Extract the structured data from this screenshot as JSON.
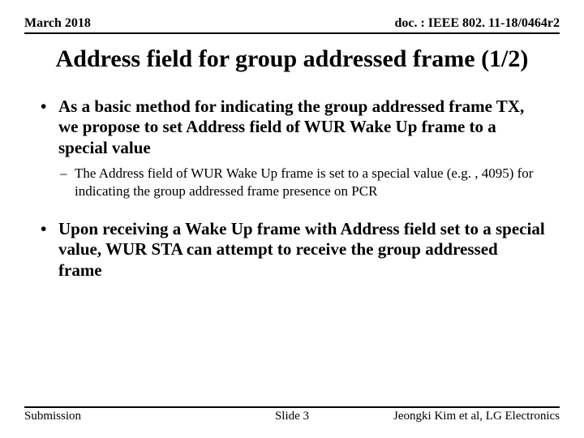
{
  "header": {
    "date": "March 2018",
    "docref": "doc. : IEEE 802. 11-18/0464r2"
  },
  "title": "Address field for group addressed frame (1/2)",
  "bullets": [
    {
      "text": "As a basic method for indicating the group addressed frame TX, we propose to set Address field of WUR Wake Up frame to a special value",
      "sub": [
        "The Address field of WUR Wake Up frame is set to a special value (e.g. , 4095) for indicating the group addressed frame presence on PCR"
      ]
    },
    {
      "text": "Upon receiving a Wake Up frame with Address field set to a special value, WUR STA can attempt to receive the group addressed frame",
      "sub": []
    }
  ],
  "footer": {
    "left": "Submission",
    "center": "Slide 3",
    "right": "Jeongki Kim et al, LG Electronics"
  }
}
